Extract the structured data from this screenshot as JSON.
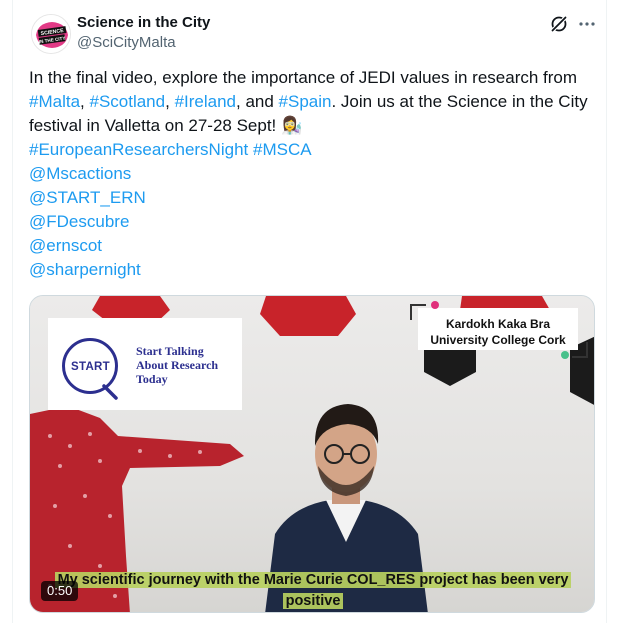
{
  "author": {
    "name": "Science in the City",
    "handle": "@SciCityMalta",
    "avatar_text": [
      "SCIENCE",
      "IN THE CITY"
    ]
  },
  "icons": {
    "grok": "grok-icon",
    "more": "more-icon"
  },
  "tweet": {
    "t1": "In the final video, explore the importance of JEDI values in research from ",
    "h_malta": "#Malta",
    "sep1": ", ",
    "h_scotland": "#Scotland",
    "sep2": ", ",
    "h_ireland": "#Ireland",
    "t2": ", and ",
    "h_spain": "#Spain",
    "t3": ". Join us at the Science in the City festival in Valletta on 27-28 Sept! ",
    "emoji": "👩‍🔬",
    "h_ern": "#EuropeanResearchersNight",
    "h_msca": "#MSCA",
    "m1": "@Mscactions",
    "m2": "@START_ERN",
    "m3": "@FDescubre",
    "m4": "@ernscot",
    "m5": "@sharpernight"
  },
  "media": {
    "logo_word": "START",
    "logo_tagline": "Start Talking About Research Today",
    "speaker_name": "Kardokh Kaka Bra",
    "speaker_affiliation": "University College Cork",
    "caption": "My scientific journey with the Marie Curie COL_RES project has been very positive",
    "timer": "0:50"
  },
  "colors": {
    "link": "#1d9bf0",
    "text": "#0f1419",
    "secondary": "#536471",
    "brand_blue": "#2c2f8f",
    "hex_red": "#c8232a",
    "hex_black": "#1b1b1b",
    "caption_highlight": "#b8d060"
  }
}
